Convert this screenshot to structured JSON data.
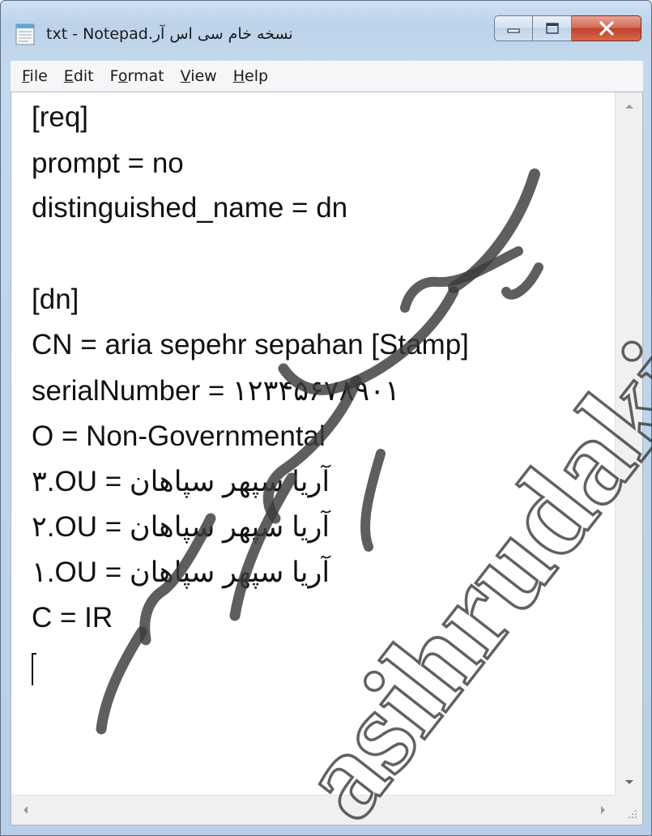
{
  "window": {
    "title": "نسخه خام سی اس آر.txt - Notepad",
    "icon": "notepad-icon"
  },
  "caption_buttons": {
    "minimize_icon": "minimize-icon",
    "maximize_icon": "maximize-icon",
    "close_icon": "close-icon"
  },
  "menu": [
    {
      "accel": "F",
      "rest": "ile"
    },
    {
      "accel": "E",
      "rest": "dit"
    },
    {
      "pre": "F",
      "accel": "o",
      "rest": "rmat"
    },
    {
      "accel": "V",
      "rest": "iew"
    },
    {
      "accel": "H",
      "rest": "elp"
    }
  ],
  "lines": [
    "[req]",
    "prompt = no",
    "distinguished_name = dn",
    "",
    "[dn]",
    "CN = aria sepehr sepahan [Stamp]",
    "serialNumber = ۱۲۳۴۵۶۷۸۹۰۱",
    "O = Non-Governmental",
    "۳.OU = آریا سپهر سپاهان",
    "۲.OU = آریا سپهر سپاهان",
    "۱.OU = آریا سپهر سپاهان",
    "C = IR",
    ""
  ],
  "watermark": {
    "latin": "asihrudaki",
    "persian": "سید مسیح رودکی",
    "color": "#3a3a3a"
  },
  "scrollbars": {
    "up_arrow": "scroll-up-icon",
    "down_arrow": "scroll-down-icon",
    "left_arrow": "scroll-left-icon",
    "right_arrow": "scroll-right-icon"
  }
}
